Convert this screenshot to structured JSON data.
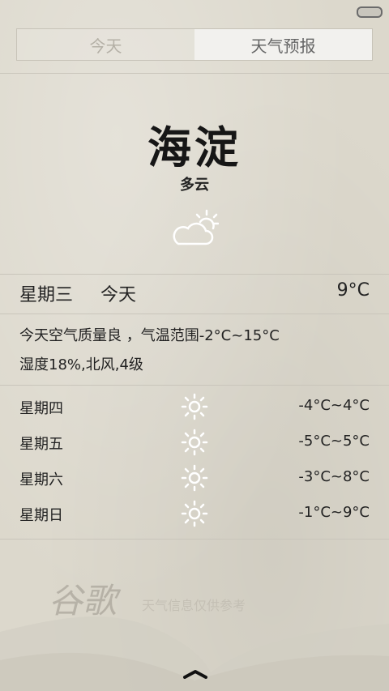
{
  "tabs": [
    "今天",
    "天气预报"
  ],
  "active_tab": 1,
  "city": "海淀",
  "condition": "多云",
  "today": {
    "day": "星期三",
    "label": "今天",
    "temp": "9°C"
  },
  "details": {
    "line1": "今天空气质量良 ，气温范围-2°C~15°C",
    "line2": "湿度18%,北风,4级"
  },
  "forecast": [
    {
      "day": "星期四",
      "icon": "sun-icon",
      "temp": "-4°C~4°C"
    },
    {
      "day": "星期五",
      "icon": "sun-icon",
      "temp": "-5°C~5°C"
    },
    {
      "day": "星期六",
      "icon": "sun-icon",
      "temp": "-3°C~8°C"
    },
    {
      "day": "星期日",
      "icon": "sun-icon",
      "temp": "-1°C~9°C"
    }
  ],
  "watermark": {
    "logo": "谷歌",
    "provider": "天气信息仅供参考"
  },
  "icons": {
    "toggle": "toggle-icon",
    "condition": "partly-cloudy-icon",
    "expand": "chevron-up-icon"
  },
  "colors": {
    "background": "#dcd8cc",
    "divider": "#c9c5bb",
    "active_tab": "#f2f1ee"
  }
}
